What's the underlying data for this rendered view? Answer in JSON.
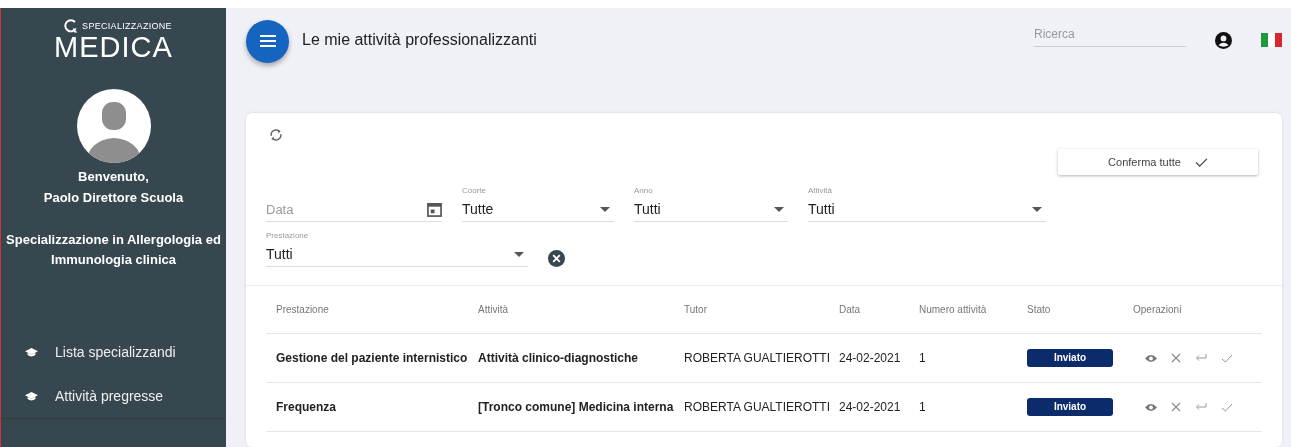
{
  "sidebar": {
    "logo": {
      "top": "SPECIALIZZAZIONE",
      "main": "MEDICA"
    },
    "welcome": "Benvenuto,",
    "user": "Paolo Direttore Scuola",
    "school": "Specializzazione in Allergologia ed Immunologia clinica",
    "items": [
      {
        "label": "Lista specializzandi",
        "selected": false
      },
      {
        "label": "Attività pregresse",
        "selected": false
      }
    ]
  },
  "header": {
    "title": "Le mie attività professionalizzanti",
    "search": {
      "placeholder": "Ricerca"
    }
  },
  "card": {
    "confirm_button": "Conferma tutte",
    "filters": [
      {
        "kind": "date",
        "placeholder": "Data"
      },
      {
        "kind": "select",
        "label": "Coorte",
        "value": "Tutte"
      },
      {
        "kind": "select",
        "label": "Anno",
        "value": "Tutti"
      },
      {
        "kind": "select",
        "label": "Attività",
        "value": "Tutti"
      }
    ],
    "filter2": {
      "kind": "select",
      "label": "Prestazione",
      "value": "Tutti"
    },
    "table": {
      "columns": [
        "Prestazione",
        "Attività",
        "Tutor",
        "Data",
        "Numero attività",
        "Stato",
        "Operazioni"
      ],
      "rows": [
        {
          "prestazione": "Gestione del paziente internistico",
          "attivita": "Attività clinico-diagnostiche",
          "tutor": "ROBERTA GUALTIEROTTI",
          "data": "24-02-2021",
          "numero": "1",
          "stato": "Inviato"
        },
        {
          "prestazione": "Frequenza",
          "attivita": "[Tronco comune] Medicina interna",
          "tutor": "ROBERTA GUALTIEROTTI",
          "data": "24-02-2021",
          "numero": "1",
          "stato": "Inviato"
        }
      ]
    }
  }
}
